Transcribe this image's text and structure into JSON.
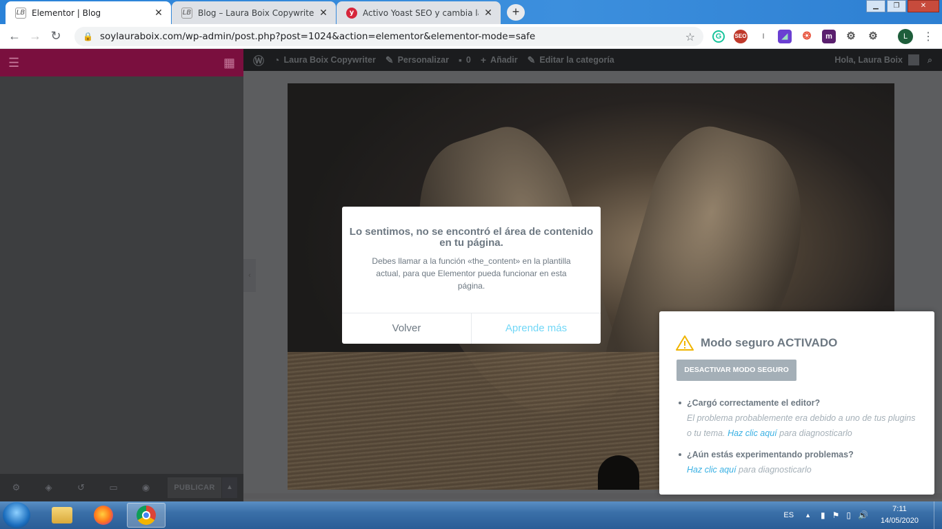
{
  "browser": {
    "tabs": [
      {
        "title": "Elementor | Blog",
        "favicon": "LB",
        "active": true
      },
      {
        "title": "Blog – Laura Boix Copywriter",
        "favicon": "LB",
        "active": false
      },
      {
        "title": "Activo Yoast SEO y cambia la apa",
        "favicon": "y",
        "active": false
      }
    ],
    "url": "soylauraboix.com/wp-admin/post.php?post=1024&action=elementor&elementor-mode=safe",
    "profile_initial": "L",
    "extensions": [
      "grammarly-icon",
      "seo-icon",
      "cursor-icon",
      "kite-icon",
      "lastpass-icon",
      "m-icon",
      "gear-icon",
      "settings-icon"
    ]
  },
  "elementor_panel": {
    "publish_label": "PUBLICAR",
    "footer_icons": [
      "settings-icon",
      "layers-icon",
      "history-icon",
      "responsive-icon",
      "preview-icon"
    ]
  },
  "wp_admin_bar": {
    "site_name": "Laura Boix Copywriter",
    "customize": "Personalizar",
    "comments_count": "0",
    "new": "Añadir",
    "edit_category": "Editar la categoría",
    "greeting": "Hola, Laura Boix"
  },
  "modal": {
    "title": "Lo sentimos, no se encontró el área de contenido en tu página.",
    "message": "Debes llamar a la función «the_content» en la plantilla actual, para que Elementor pueda funcionar en esta página.",
    "back_label": "Volver",
    "learn_label": "Aprende más"
  },
  "safe_mode": {
    "title": "Modo seguro ACTIVADO",
    "button": "DESACTIVAR MODO SEGURO",
    "items": [
      {
        "question": "¿Cargó correctamente el editor?",
        "answer": "El problema probablemente era debido a uno de tus plugins o tu tema.",
        "link": "Haz clic aquí",
        "tail": "para diagnosticarlo"
      },
      {
        "question": "¿Aún estás experimentando problemas?",
        "answer": "",
        "link": "Haz clic aquí",
        "tail": "para diagnosticarlo"
      }
    ],
    "accent_link": "#39b0e3"
  },
  "taskbar": {
    "language": "ES",
    "time": "7:11",
    "date": "14/05/2020"
  }
}
